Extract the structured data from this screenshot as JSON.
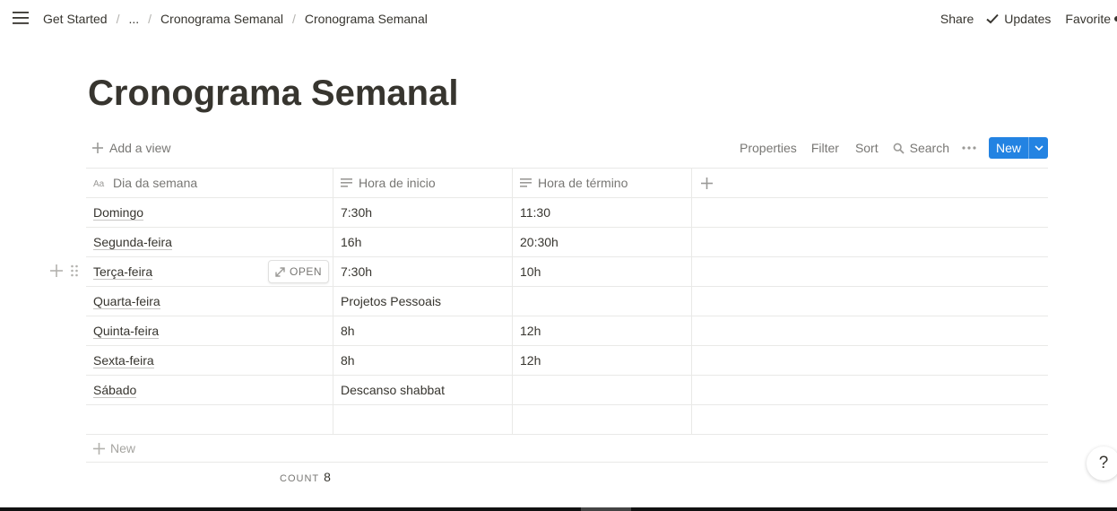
{
  "breadcrumbs": [
    "Get Started",
    "...",
    "Cronograma Semanal",
    "Cronograma Semanal"
  ],
  "top_actions": {
    "share": "Share",
    "updates": "Updates",
    "favorite": "Favorite"
  },
  "page_title": "Cronograma Semanal",
  "viewbar": {
    "add_view": "Add a view",
    "properties": "Properties",
    "filter": "Filter",
    "sort": "Sort",
    "search": "Search",
    "new": "New"
  },
  "table": {
    "columns": [
      "Dia da semana",
      "Hora de inicio",
      "Hora de término"
    ],
    "rows": [
      {
        "day": "Domingo",
        "start": "7:30h",
        "end": "11:30"
      },
      {
        "day": "Segunda-feira",
        "start": "16h",
        "end": "20:30h"
      },
      {
        "day": "Terça-feira",
        "start": "7:30h",
        "end": "10h"
      },
      {
        "day": "Quarta-feira",
        "start": "Projetos Pessoais",
        "end": ""
      },
      {
        "day": "Quinta-feira",
        "start": "8h",
        "end": "12h"
      },
      {
        "day": "Sexta-feira",
        "start": "8h",
        "end": "12h"
      },
      {
        "day": "Sábado",
        "start": "Descanso shabbat",
        "end": ""
      },
      {
        "day": "",
        "start": "",
        "end": ""
      }
    ],
    "open_label": "OPEN",
    "new_row": "New"
  },
  "count": {
    "label": "COUNT",
    "value": "8"
  },
  "help": "?",
  "colors": {
    "accent": "#2383e2",
    "text": "#37352f",
    "muted": "#787774"
  }
}
